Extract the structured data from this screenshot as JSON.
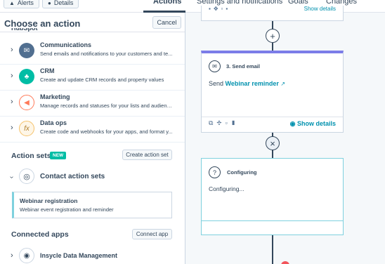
{
  "topbar": {
    "alerts_label": "Alerts",
    "details_label": "Details",
    "tabs": [
      {
        "label": "Actions"
      },
      {
        "label": "Settings and notifications"
      },
      {
        "label": "Goals"
      },
      {
        "label": "Changes"
      }
    ]
  },
  "panel": {
    "title": "Choose an action",
    "cancel_label": "Cancel",
    "cutoff_section": "HubSpot",
    "categories": [
      {
        "title": "Communications",
        "desc": "Send emails and notifications to your customers and te...",
        "icon": "envelope-icon",
        "color": "#516f90"
      },
      {
        "title": "CRM",
        "desc": "Create and update CRM records and property values",
        "icon": "people-icon",
        "color": "#00bda5"
      },
      {
        "title": "Marketing",
        "desc": "Manage records and statuses for your lists and audienc...",
        "icon": "megaphone-icon",
        "color": "#ff7a59"
      },
      {
        "title": "Data ops",
        "desc": "Create code and webhooks for your apps, and format y...",
        "icon": "function-icon",
        "color": "#f5c26b"
      }
    ],
    "action_sets": {
      "heading": "Action sets",
      "badge": "NEW",
      "create_label": "Create action set",
      "contact_sets_title": "Contact action sets",
      "webinar": {
        "title": "Webinar registration",
        "desc": "Webinar event registration and reminder"
      }
    },
    "connected_apps": {
      "heading": "Connected apps",
      "connect_label": "Connect app",
      "first_app": "Insycle Data Management"
    }
  },
  "canvas": {
    "top_card_show": "Show details",
    "plus_symbol": "+",
    "email_card": {
      "title": "3. Send email",
      "body_prefix": "Send",
      "link": "Webinar reminder",
      "show_details": "Show details"
    },
    "close_symbol": "×",
    "config_card": {
      "title": "Configuring",
      "body": "Configuring..."
    },
    "colors": {
      "email_accent": "#7b7ce8",
      "config_border": "#7fd1de",
      "link": "#0091ae"
    }
  }
}
